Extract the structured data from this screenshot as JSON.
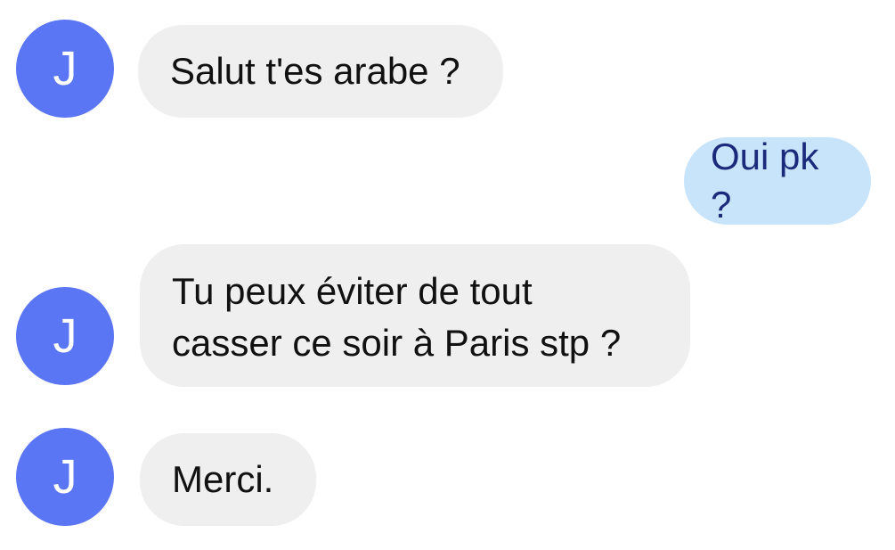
{
  "contact": {
    "initial": "J",
    "avatar_color": "#5b76f5"
  },
  "colors": {
    "incoming_bubble": "#efefef",
    "outgoing_bubble": "#c7e4fb",
    "outgoing_text": "#1b2a7a"
  },
  "messages": [
    {
      "direction": "incoming",
      "text": "Salut t'es arabe ?"
    },
    {
      "direction": "outgoing",
      "text": "Oui pk ?"
    },
    {
      "direction": "incoming",
      "lines": [
        "Tu peux éviter de tout",
        "casser ce soir à Paris stp ?"
      ]
    },
    {
      "direction": "incoming",
      "text": "Merci."
    }
  ]
}
